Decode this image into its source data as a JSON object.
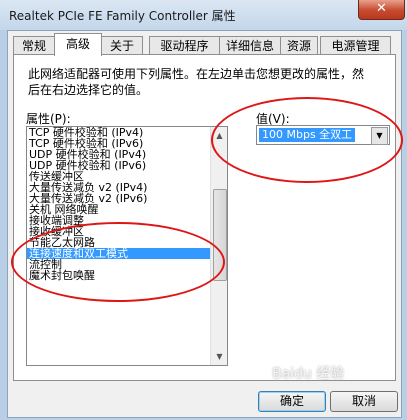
{
  "window": {
    "title": "Realtek PCIe FE Family Controller 属性",
    "close_label": "✕"
  },
  "tabs": [
    {
      "label": "常规",
      "active": false
    },
    {
      "label": "高级",
      "active": true
    },
    {
      "label": "关于",
      "active": false
    },
    {
      "label": "驱动程序",
      "active": false
    },
    {
      "label": "详细信息",
      "active": false
    },
    {
      "label": "资源",
      "active": false
    },
    {
      "label": "电源管理",
      "active": false
    }
  ],
  "advanced": {
    "description": "此网络适配器可使用下列属性。在左边单击您想更改的属性，然后在右边选择它的值。",
    "property_label": "属性(P):",
    "value_label": "值(V):",
    "properties": [
      "TCP 硬件校验和 (IPv4)",
      "TCP 硬件校验和 (IPv6)",
      "UDP 硬件校验和 (IPv4)",
      "UDP 硬件校验和 (IPv6)",
      "传送缓冲区",
      "大量传送减负 v2 (IPv4)",
      "大量传送减负 v2 (IPv6)",
      "关机 网络唤醒",
      "接收端调整",
      "接收缓冲区",
      "节能乙太网路",
      "连接速度和双工模式",
      "流控制",
      "魔术封包唤醒"
    ],
    "selected_index": 11,
    "selected_value": "100 Mbps 全双工"
  },
  "buttons": {
    "ok": "确定",
    "cancel": "取消"
  },
  "watermark": "Baidu 经验",
  "colors": {
    "selection": "#3399ff",
    "annotation": "#e01616"
  }
}
